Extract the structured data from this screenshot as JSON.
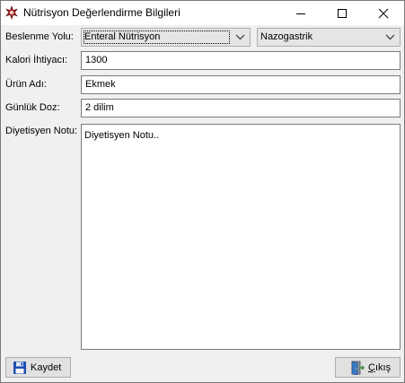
{
  "window": {
    "title": "Nütrisyon Değerlendirme Bilgileri",
    "controls": [
      "minimize-icon",
      "maximize-icon",
      "close-icon"
    ]
  },
  "form": {
    "feeding_label": "Beslenme Yolu:",
    "feeding_type_value": "Enteral Nütrisyon",
    "feeding_route_value": "Nazogastrik",
    "calorie_label": "Kalori İhtiyacı:",
    "calorie_value": "1300",
    "product_label": "Ürün Adı:",
    "product_value": "Ekmek",
    "dose_label": "Günlük Doz:",
    "dose_value": "2 dilim",
    "note_label": "Diyetisyen Notu:",
    "note_value": "Diyetisyen Notu.."
  },
  "buttons": {
    "save_label": "Kaydet",
    "exit_label": "Çıkış"
  },
  "icons": {
    "app": "red-cross-app-icon",
    "save": "floppy-disk-icon",
    "exit": "door-exit-icon"
  }
}
